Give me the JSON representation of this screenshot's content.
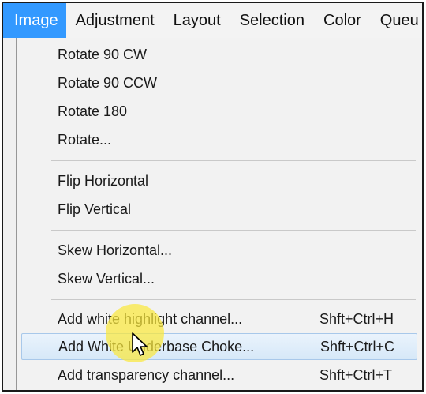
{
  "menubar": {
    "items": [
      {
        "label": "Image",
        "active": true
      },
      {
        "label": "Adjustment"
      },
      {
        "label": "Layout"
      },
      {
        "label": "Selection"
      },
      {
        "label": "Color"
      },
      {
        "label": "Queu"
      }
    ]
  },
  "image_menu": {
    "items": [
      {
        "label": "Rotate 90 CW",
        "shortcut": ""
      },
      {
        "label": "Rotate 90 CCW",
        "shortcut": ""
      },
      {
        "label": "Rotate 180",
        "shortcut": ""
      },
      {
        "label": "Rotate...",
        "shortcut": ""
      },
      {
        "label": "Flip Horizontal",
        "shortcut": ""
      },
      {
        "label": "Flip Vertical",
        "shortcut": ""
      },
      {
        "label": "Skew Horizontal...",
        "shortcut": ""
      },
      {
        "label": "Skew Vertical...",
        "shortcut": ""
      },
      {
        "label": "Add white highlight channel...",
        "shortcut": "Shft+Ctrl+H"
      },
      {
        "label": "Add White Underbase Choke...",
        "shortcut": "Shft+Ctrl+C",
        "selected": true
      },
      {
        "label": "Add transparency channel...",
        "shortcut": "Shft+Ctrl+T"
      }
    ]
  },
  "colors": {
    "active_menu": "#3399ff",
    "selected_item": "#d6e8f8",
    "cursor_highlight": "#fae83c"
  },
  "icons": {
    "cursor": "mouse-pointer-icon"
  }
}
